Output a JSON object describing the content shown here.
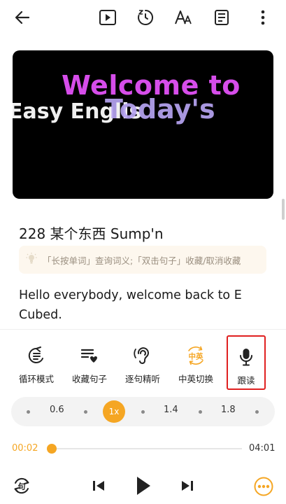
{
  "colors": {
    "accent": "#f5a623",
    "highlight_border": "#e02020",
    "video_bg": "#000000"
  },
  "topbar": {
    "icons": [
      "back-arrow-icon",
      "play-video-icon",
      "timer-icon",
      "font-size-icon",
      "notes-icon",
      "more-vertical-icon"
    ]
  },
  "video": {
    "line1": "Welcome to",
    "line2": "Easy Englis",
    "line3": "Today's"
  },
  "lesson": {
    "title": "228 某个东西 Sump'n",
    "hint": "「长按单词」查询词义;「双击句子」收藏/取消收藏",
    "hint_icon": "lightbulb-icon",
    "sentence": "Hello everybody, welcome back to E Cubed."
  },
  "functions": [
    {
      "label": "循环模式",
      "icon": "loop-mode-icon"
    },
    {
      "label": "收藏句子",
      "icon": "favorite-sentence-icon"
    },
    {
      "label": "逐句精听",
      "icon": "listen-ear-icon"
    },
    {
      "label": "中英切换",
      "icon": "language-toggle-icon",
      "icon_text": "中英"
    },
    {
      "label": "跟读",
      "icon": "microphone-icon"
    }
  ],
  "speed": {
    "options": [
      "0.6",
      "1x",
      "1.4",
      "1.8"
    ],
    "selected": "1x"
  },
  "progress": {
    "current": "00:02",
    "total": "04:01",
    "fraction": 0.008
  },
  "controls": {
    "icons": [
      "sentence-repeat-icon",
      "previous-sentence-icon",
      "play-icon",
      "next-sentence-icon",
      "more-options-icon"
    ],
    "repeat_glyph": "句"
  }
}
